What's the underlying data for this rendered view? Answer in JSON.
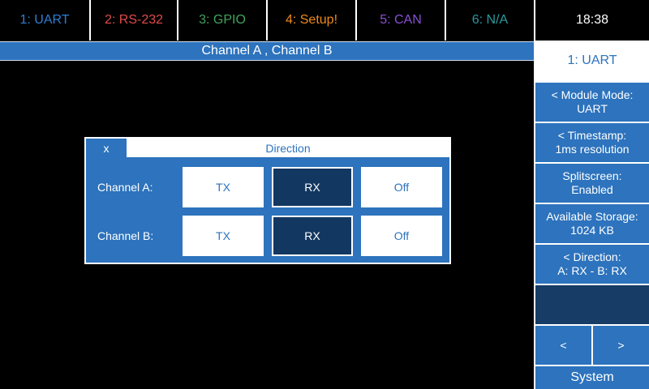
{
  "colors": {
    "accent": "#2d73bd",
    "selected": "#123761",
    "background": "#000000"
  },
  "tabs": [
    {
      "label": "1: UART",
      "color": "#2f7fd4"
    },
    {
      "label": "2: RS-232",
      "color": "#e04a4a"
    },
    {
      "label": "3: GPIO",
      "color": "#3fa35c"
    },
    {
      "label": "4: Setup!",
      "color": "#f08a1c"
    },
    {
      "label": "5: CAN",
      "color": "#8a4fd6"
    },
    {
      "label": "6: N/A",
      "color": "#2a9aa0"
    }
  ],
  "clock": "18:38",
  "channel_header": "Channel A , Channel B",
  "sidebar": {
    "title": "1: UART",
    "buttons": [
      {
        "line1": "< Module Mode:",
        "line2": "UART"
      },
      {
        "line1": "< Timestamp:",
        "line2": "1ms resolution"
      },
      {
        "line1": "Splitscreen:",
        "line2": "Enabled"
      },
      {
        "line1": "Available Storage:",
        "line2": "1024 KB"
      },
      {
        "line1": "< Direction:",
        "line2": "A: RX - B: RX"
      }
    ],
    "prev": "<",
    "next": ">",
    "system": "System"
  },
  "dialog": {
    "close": "x",
    "title": "Direction",
    "rows": [
      {
        "label": "Channel A:",
        "options": [
          "TX",
          "RX",
          "Off"
        ],
        "selected": 1
      },
      {
        "label": "Channel B:",
        "options": [
          "TX",
          "RX",
          "Off"
        ],
        "selected": 1
      }
    ]
  }
}
